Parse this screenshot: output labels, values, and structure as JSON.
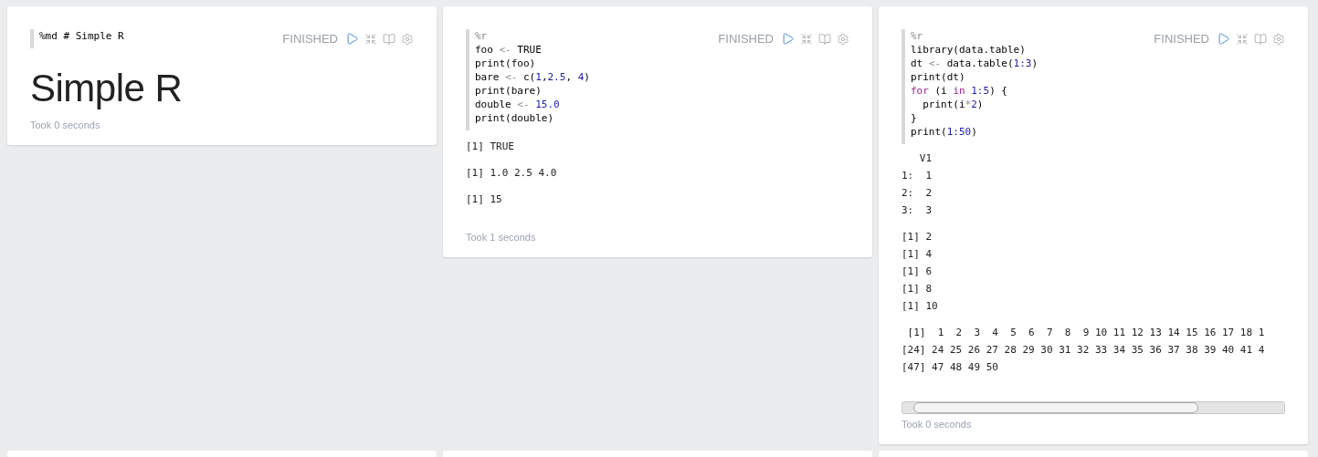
{
  "paragraphs": [
    {
      "status": "FINISHED",
      "code": [
        [
          {
            "kind": "plain",
            "text": "%md # Simple R"
          }
        ]
      ],
      "result": {
        "kind": "heading",
        "text": "Simple R"
      },
      "took": "Took 0 seconds"
    },
    {
      "status": "FINISHED",
      "code": [
        [
          {
            "kind": "op",
            "text": "%r"
          }
        ],
        [
          {
            "kind": "plain",
            "text": "foo "
          },
          {
            "kind": "op",
            "text": "<-"
          },
          {
            "kind": "plain",
            "text": " TRUE"
          }
        ],
        [
          {
            "kind": "plain",
            "text": "print(foo)"
          }
        ],
        [
          {
            "kind": "plain",
            "text": "bare "
          },
          {
            "kind": "op",
            "text": "<-"
          },
          {
            "kind": "plain",
            "text": " c("
          },
          {
            "kind": "num",
            "text": "1"
          },
          {
            "kind": "plain",
            "text": ","
          },
          {
            "kind": "num",
            "text": "2.5"
          },
          {
            "kind": "plain",
            "text": ", "
          },
          {
            "kind": "num",
            "text": "4"
          },
          {
            "kind": "plain",
            "text": ")"
          }
        ],
        [
          {
            "kind": "plain",
            "text": "print(bare)"
          }
        ],
        [
          {
            "kind": "plain",
            "text": "double "
          },
          {
            "kind": "op",
            "text": "<-"
          },
          {
            "kind": "num",
            "text": " 15.0"
          }
        ],
        [
          {
            "kind": "plain",
            "text": "print(double)"
          }
        ]
      ],
      "result": {
        "kind": "text",
        "blocks": [
          [
            "[1] TRUE"
          ],
          [
            "[1] 1.0 2.5 4.0"
          ],
          [
            "[1] 15"
          ]
        ]
      },
      "took": "Took 1 seconds"
    },
    {
      "status": "FINISHED",
      "code": [
        [
          {
            "kind": "op",
            "text": "%r"
          }
        ],
        [
          {
            "kind": "plain",
            "text": "library(data.table)"
          }
        ],
        [
          {
            "kind": "plain",
            "text": "dt "
          },
          {
            "kind": "op",
            "text": "<-"
          },
          {
            "kind": "plain",
            "text": " data.table("
          },
          {
            "kind": "num",
            "text": "1:3"
          },
          {
            "kind": "plain",
            "text": ")"
          }
        ],
        [
          {
            "kind": "plain",
            "text": "print(dt)"
          }
        ],
        [
          {
            "kind": "kw",
            "text": "for"
          },
          {
            "kind": "plain",
            "text": " (i "
          },
          {
            "kind": "kw",
            "text": "in"
          },
          {
            "kind": "num",
            "text": " 1:5"
          },
          {
            "kind": "plain",
            "text": ") {"
          }
        ],
        [
          {
            "kind": "plain",
            "text": "  print(i"
          },
          {
            "kind": "op",
            "text": "*"
          },
          {
            "kind": "num",
            "text": "2"
          },
          {
            "kind": "plain",
            "text": ")"
          }
        ],
        [
          {
            "kind": "plain",
            "text": "}"
          }
        ],
        [
          {
            "kind": "plain",
            "text": "print("
          },
          {
            "kind": "num",
            "text": "1:50"
          },
          {
            "kind": "plain",
            "text": ")"
          }
        ]
      ],
      "result": {
        "kind": "scroll",
        "blocks": [
          [
            "   V1",
            "1:  1",
            "2:  2",
            "3:  3"
          ],
          [
            "[1] 2",
            "[1] 4",
            "[1] 6",
            "[1] 8",
            "[1] 10"
          ],
          [
            " [1]  1  2  3  4  5  6  7  8  9 10 11 12 13 14 15 16 17 18 1",
            "[24] 24 25 26 27 28 29 30 31 32 33 34 35 36 37 38 39 40 41 4",
            "[47] 47 48 49 50"
          ]
        ]
      },
      "took": "Took 0 seconds"
    }
  ]
}
